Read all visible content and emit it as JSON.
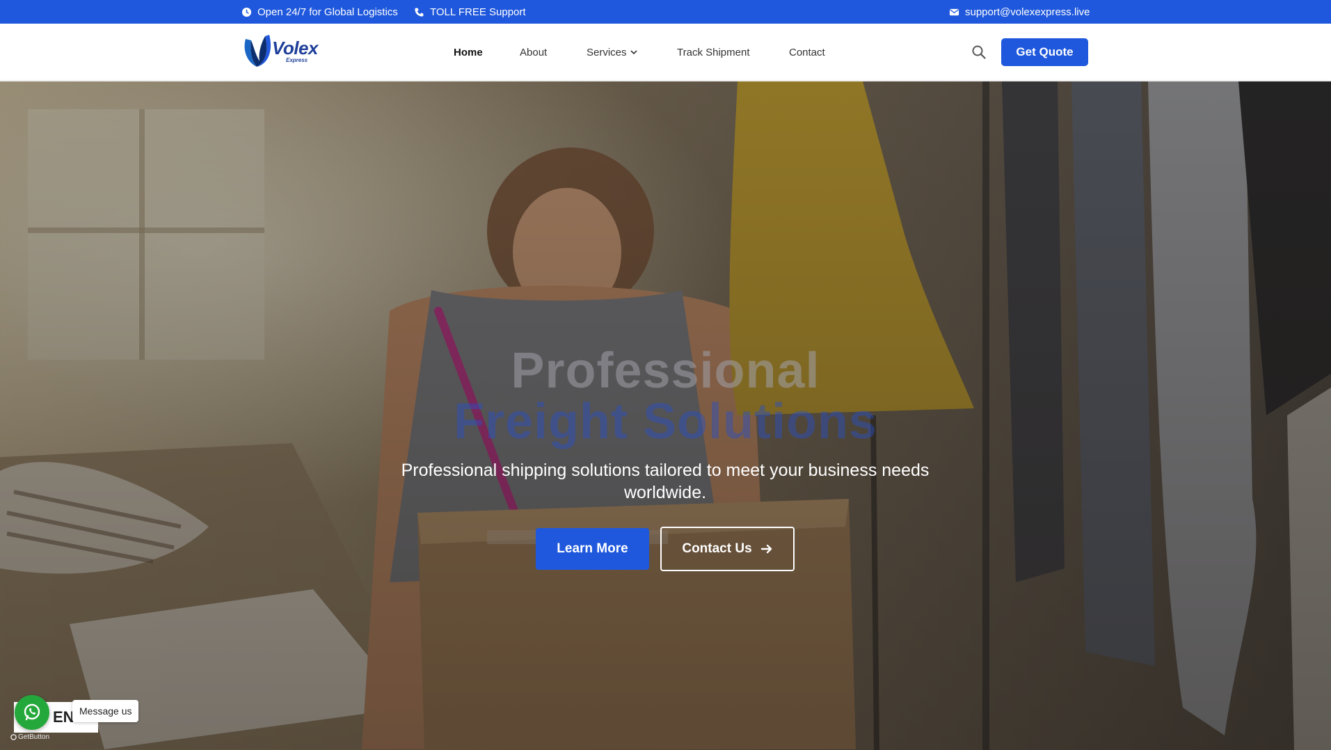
{
  "topbar": {
    "hours_text": "Open 24/7 for Global Logistics",
    "phone_text": "TOLL FREE Support",
    "email_text": "support@volexexpress.live"
  },
  "header": {
    "logo_text": "Volex",
    "logo_sub": "Express",
    "nav": {
      "home": "Home",
      "about": "About",
      "services": "Services",
      "track": "Track Shipment",
      "contact": "Contact"
    },
    "quote_label": "Get Quote"
  },
  "hero": {
    "title_line1": "Professional",
    "title_line2": "Freight Solutions",
    "subtitle": "Professional shipping solutions tailored to meet your business needs worldwide.",
    "learn_more": "Learn More",
    "contact_us": "Contact Us"
  },
  "widgets": {
    "lang": "EN",
    "message": "Message us",
    "getbutton": "GetButton"
  },
  "colors": {
    "brand": "#1f58dc",
    "whatsapp": "#25a83b"
  }
}
